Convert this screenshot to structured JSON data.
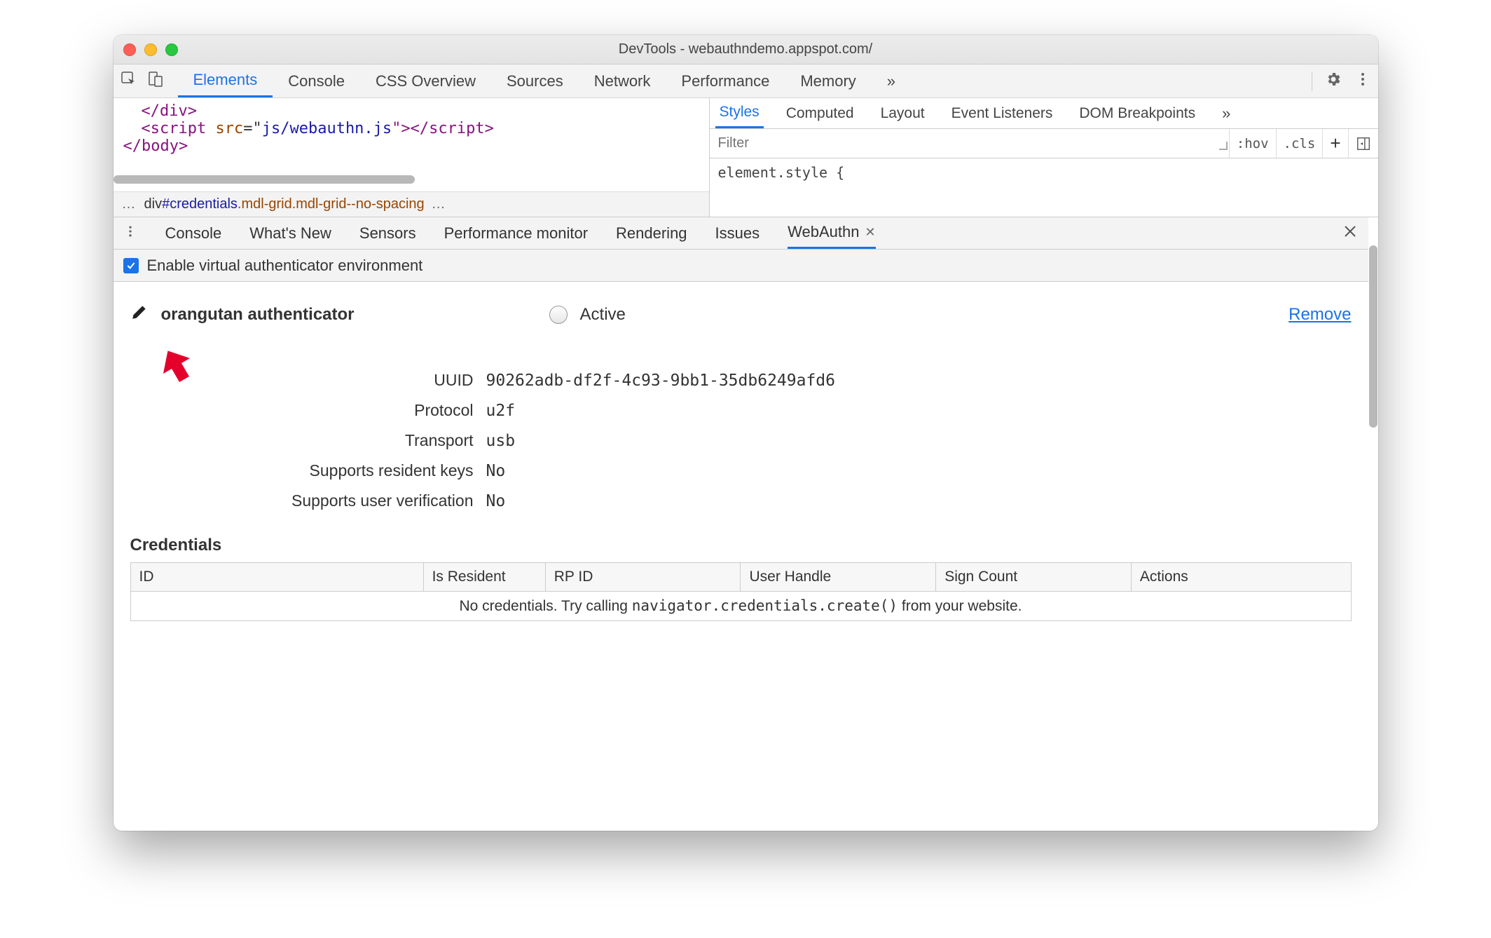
{
  "window": {
    "title": "DevTools - webauthndemo.appspot.com/"
  },
  "mainTabs": {
    "items": [
      "Elements",
      "Console",
      "CSS Overview",
      "Sources",
      "Network",
      "Performance",
      "Memory"
    ],
    "more": "»",
    "active": 0
  },
  "code": {
    "line1_open": "</",
    "line1_tag": "div",
    "line1_close": ">",
    "line2_open": "<",
    "line2_tag": "script",
    "line2_attr": "src",
    "line2_eq": "=\"",
    "line2_val": "js/webauthn.js",
    "line2_end": "\"></",
    "line2_tag2": "script",
    "line2_close": ">",
    "line3_open": "</",
    "line3_tag": "body",
    "line3_close": ">"
  },
  "breadcrumb": {
    "pre": "…",
    "el": "div",
    "id": "#credentials",
    "cls": ".mdl-grid.mdl-grid--no-spacing",
    "post": "…"
  },
  "sideTabs": {
    "items": [
      "Styles",
      "Computed",
      "Layout",
      "Event Listeners",
      "DOM Breakpoints"
    ],
    "more": "»",
    "active": 0
  },
  "filter": {
    "placeholder": "Filter",
    "hov": ":hov",
    "cls": ".cls"
  },
  "styleBlock": "element.style {",
  "drawerTabs": {
    "items": [
      "Console",
      "What's New",
      "Sensors",
      "Performance monitor",
      "Rendering",
      "Issues",
      "WebAuthn"
    ],
    "active": 6
  },
  "enable": {
    "label": "Enable virtual authenticator environment"
  },
  "authenticator": {
    "name": "orangutan authenticator",
    "activeLabel": "Active",
    "removeLabel": "Remove",
    "props": [
      {
        "k": "UUID",
        "v": "90262adb-df2f-4c93-9bb1-35db6249afd6"
      },
      {
        "k": "Protocol",
        "v": "u2f"
      },
      {
        "k": "Transport",
        "v": "usb"
      },
      {
        "k": "Supports resident keys",
        "v": "No"
      },
      {
        "k": "Supports user verification",
        "v": "No"
      }
    ]
  },
  "credentials": {
    "heading": "Credentials",
    "columns": [
      "ID",
      "Is Resident",
      "RP ID",
      "User Handle",
      "Sign Count",
      "Actions"
    ],
    "emptyPrefix": "No credentials. Try calling ",
    "emptyCode": "navigator.credentials.create()",
    "emptySuffix": " from your website."
  }
}
